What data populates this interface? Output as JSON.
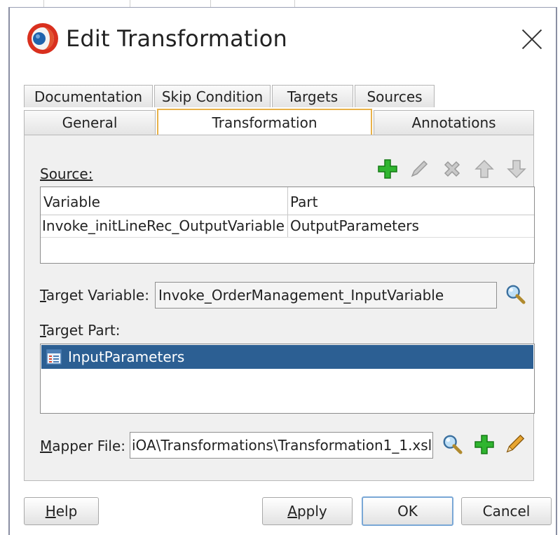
{
  "dialog": {
    "title": "Edit Transformation",
    "close_icon": "close-icon",
    "logo_icon": "oracle-jdev-logo-icon"
  },
  "tabs_row1": [
    {
      "label": "Documentation"
    },
    {
      "label": "Skip Condition"
    },
    {
      "label": "Targets"
    },
    {
      "label": "Sources"
    }
  ],
  "tabs_row2": [
    {
      "label": "General"
    },
    {
      "label": "Transformation",
      "active": true
    },
    {
      "label": "Annotations"
    }
  ],
  "source": {
    "label": "Source:",
    "toolbar": [
      "add-icon",
      "edit-icon",
      "delete-icon",
      "move-up-icon",
      "move-down-icon"
    ],
    "columns": [
      "Variable",
      "Part"
    ],
    "rows": [
      {
        "variable": "Invoke_initLineRec_OutputVariable",
        "part": "OutputParameters"
      }
    ]
  },
  "target_variable": {
    "label": "Target Variable:",
    "value": "Invoke_OrderManagement_InputVariable"
  },
  "target_part": {
    "label": "Target Part:",
    "items": [
      {
        "label": "InputParameters",
        "selected": true
      }
    ]
  },
  "mapper_file": {
    "label": "Mapper File:",
    "value": "iOA\\Transformations\\Transformation1_1.xsl"
  },
  "buttons": {
    "help": "Help",
    "apply": "Apply",
    "ok": "OK",
    "cancel": "Cancel"
  },
  "colors": {
    "selection": "#2c5f93",
    "active_tab_border": "#e8b24a",
    "add_green": "#2fb52f"
  }
}
